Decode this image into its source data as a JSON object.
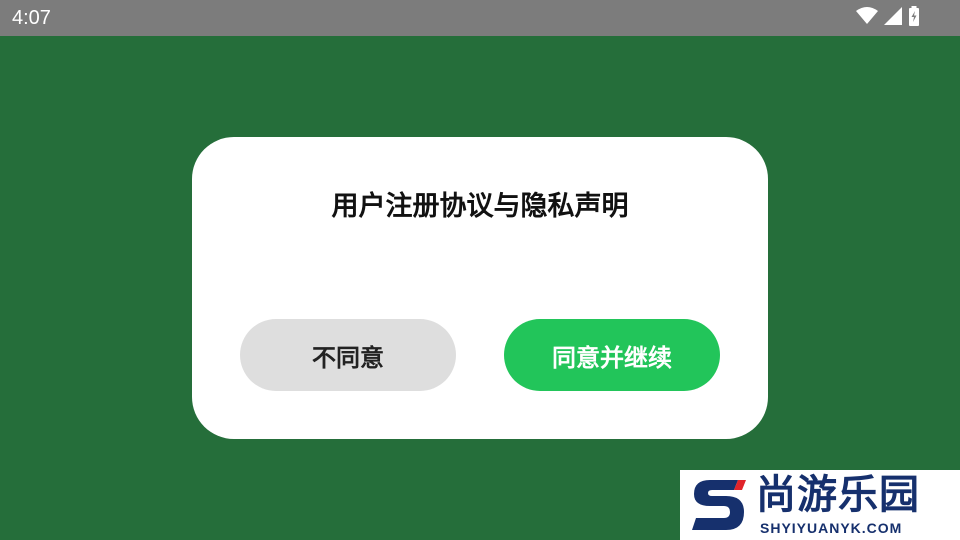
{
  "status_bar": {
    "time": "4:07",
    "icons": [
      "wifi-icon",
      "cell-signal-icon",
      "battery-charging-icon"
    ],
    "color": "#7c7c7c"
  },
  "background_color": "#256e3a",
  "dialog": {
    "title": "用户注册协议与隐私声明",
    "disagree_label": "不同意",
    "agree_label": "同意并继续",
    "agree_color": "#22c55a",
    "disagree_color": "#dedede"
  },
  "watermark": {
    "brand": "尚游乐园",
    "domain": "SHYIYUANYK.COM",
    "logo_icon": "s-logo-icon"
  }
}
